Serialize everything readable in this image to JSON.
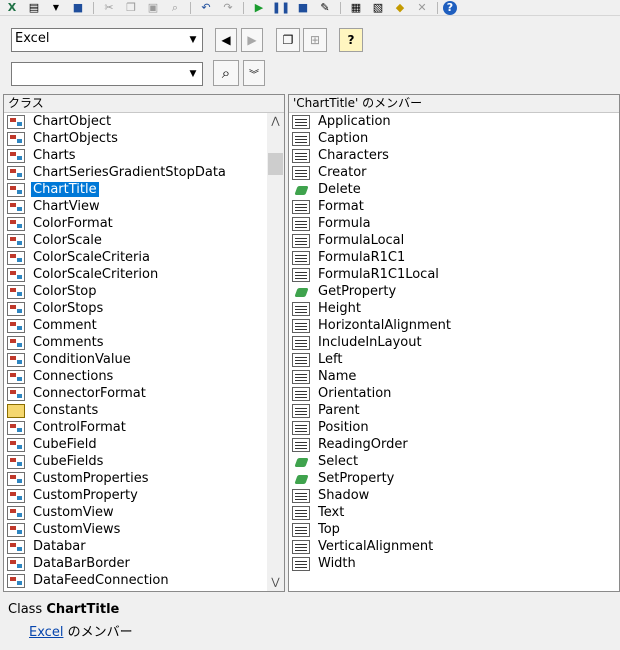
{
  "library_select": {
    "value": "Excel"
  },
  "search_select": {
    "value": ""
  },
  "classes_header": "クラス",
  "members_header": "'ChartTitle' のメンバー",
  "classes": [
    {
      "label": "ChartObject",
      "kind": "class"
    },
    {
      "label": "ChartObjects",
      "kind": "class"
    },
    {
      "label": "Charts",
      "kind": "class"
    },
    {
      "label": "ChartSeriesGradientStopData",
      "kind": "class"
    },
    {
      "label": "ChartTitle",
      "kind": "class",
      "selected": true
    },
    {
      "label": "ChartView",
      "kind": "class"
    },
    {
      "label": "ColorFormat",
      "kind": "class"
    },
    {
      "label": "ColorScale",
      "kind": "class"
    },
    {
      "label": "ColorScaleCriteria",
      "kind": "class"
    },
    {
      "label": "ColorScaleCriterion",
      "kind": "class"
    },
    {
      "label": "ColorStop",
      "kind": "class"
    },
    {
      "label": "ColorStops",
      "kind": "class"
    },
    {
      "label": "Comment",
      "kind": "class"
    },
    {
      "label": "Comments",
      "kind": "class"
    },
    {
      "label": "ConditionValue",
      "kind": "class"
    },
    {
      "label": "Connections",
      "kind": "class"
    },
    {
      "label": "ConnectorFormat",
      "kind": "class"
    },
    {
      "label": "Constants",
      "kind": "const"
    },
    {
      "label": "ControlFormat",
      "kind": "class"
    },
    {
      "label": "CubeField",
      "kind": "class"
    },
    {
      "label": "CubeFields",
      "kind": "class"
    },
    {
      "label": "CustomProperties",
      "kind": "class"
    },
    {
      "label": "CustomProperty",
      "kind": "class"
    },
    {
      "label": "CustomView",
      "kind": "class"
    },
    {
      "label": "CustomViews",
      "kind": "class"
    },
    {
      "label": "Databar",
      "kind": "class"
    },
    {
      "label": "DataBarBorder",
      "kind": "class"
    },
    {
      "label": "DataFeedConnection",
      "kind": "class"
    }
  ],
  "members": [
    {
      "label": "Application",
      "kind": "prop"
    },
    {
      "label": "Caption",
      "kind": "prop"
    },
    {
      "label": "Characters",
      "kind": "prop"
    },
    {
      "label": "Creator",
      "kind": "prop"
    },
    {
      "label": "Delete",
      "kind": "method"
    },
    {
      "label": "Format",
      "kind": "prop"
    },
    {
      "label": "Formula",
      "kind": "prop"
    },
    {
      "label": "FormulaLocal",
      "kind": "prop"
    },
    {
      "label": "FormulaR1C1",
      "kind": "prop"
    },
    {
      "label": "FormulaR1C1Local",
      "kind": "prop"
    },
    {
      "label": "GetProperty",
      "kind": "method"
    },
    {
      "label": "Height",
      "kind": "prop"
    },
    {
      "label": "HorizontalAlignment",
      "kind": "prop"
    },
    {
      "label": "IncludeInLayout",
      "kind": "prop"
    },
    {
      "label": "Left",
      "kind": "prop"
    },
    {
      "label": "Name",
      "kind": "prop"
    },
    {
      "label": "Orientation",
      "kind": "prop"
    },
    {
      "label": "Parent",
      "kind": "prop"
    },
    {
      "label": "Position",
      "kind": "prop"
    },
    {
      "label": "ReadingOrder",
      "kind": "prop"
    },
    {
      "label": "Select",
      "kind": "method"
    },
    {
      "label": "SetProperty",
      "kind": "method"
    },
    {
      "label": "Shadow",
      "kind": "prop"
    },
    {
      "label": "Text",
      "kind": "prop"
    },
    {
      "label": "Top",
      "kind": "prop"
    },
    {
      "label": "VerticalAlignment",
      "kind": "prop"
    },
    {
      "label": "Width",
      "kind": "prop"
    }
  ],
  "footer": {
    "class_prefix": "Class",
    "class_name": "ChartTitle",
    "library_link": "Excel",
    "member_suffix": "のメンバー"
  }
}
